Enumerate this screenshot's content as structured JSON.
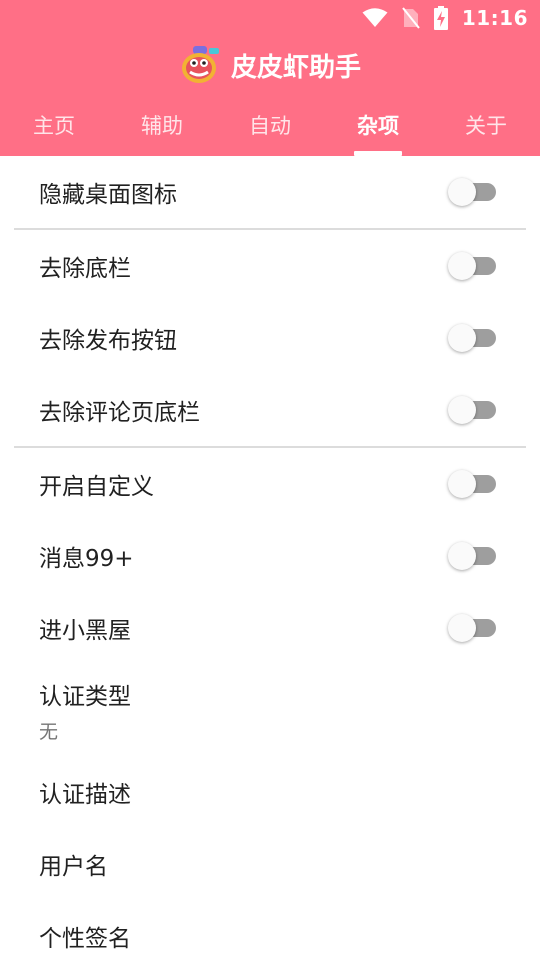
{
  "status": {
    "time": "11:16"
  },
  "app": {
    "title": "皮皮虾助手",
    "logo_icon": "shrimp-mascot-icon"
  },
  "colors": {
    "brand": "#ff6f86",
    "switch_off_track": "#9e9e9e"
  },
  "tabs": [
    {
      "label": "主页",
      "active": false
    },
    {
      "label": "辅助",
      "active": false
    },
    {
      "label": "自动",
      "active": false
    },
    {
      "label": "杂项",
      "active": true
    },
    {
      "label": "关于",
      "active": false
    }
  ],
  "settings": {
    "hide_icon": {
      "label": "隐藏桌面图标",
      "on": false
    },
    "remove_bottom_bar": {
      "label": "去除底栏",
      "on": false
    },
    "remove_publish_button": {
      "label": "去除发布按钮",
      "on": false
    },
    "remove_comment_bottom_bar": {
      "label": "去除评论页底栏",
      "on": false
    },
    "enable_custom": {
      "label": "开启自定义",
      "on": false
    },
    "message_99": {
      "label": "消息99+",
      "on": false
    },
    "black_room": {
      "label": "进小黑屋",
      "on": false
    },
    "verify_type": {
      "label": "认证类型",
      "value": "无"
    },
    "verify_desc": {
      "label": "认证描述"
    },
    "username": {
      "label": "用户名"
    },
    "signature": {
      "label": "个性签名"
    }
  }
}
